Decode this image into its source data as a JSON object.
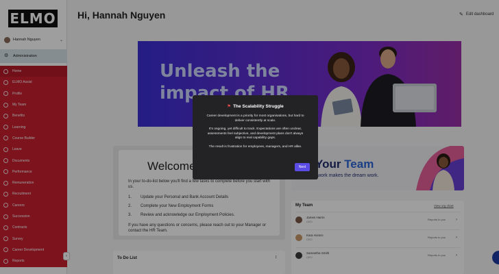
{
  "brand": {
    "logo_text": "ELMO"
  },
  "user": {
    "name": "Hannah Nguyen"
  },
  "sidebar": {
    "admin_label": "Administration",
    "items": [
      {
        "label": "Home"
      },
      {
        "label": "ELMO Assist"
      },
      {
        "label": "Profile"
      },
      {
        "label": "My Team"
      },
      {
        "label": "Benefits"
      },
      {
        "label": "Learning"
      },
      {
        "label": "Course Builder"
      },
      {
        "label": "Leave"
      },
      {
        "label": "Documents"
      },
      {
        "label": "Performance"
      },
      {
        "label": "Remuneration"
      },
      {
        "label": "Recruitment"
      },
      {
        "label": "Careers"
      },
      {
        "label": "Succession"
      },
      {
        "label": "Contracts"
      },
      {
        "label": "Survey"
      },
      {
        "label": "Career Development"
      },
      {
        "label": "Reports"
      }
    ],
    "active_index": 0,
    "colors": {
      "nav_bg": "#c9202f"
    }
  },
  "header": {
    "greeting": "Hi, Hannah Nguyen",
    "edit_dashboard": "Edit dashboard"
  },
  "banner": {
    "headline_line1": "Unleash the",
    "headline_line2": "impact of HR"
  },
  "welcome": {
    "title": "Welcome",
    "intro": "In your to-do-list below you'll find a few tasks to complete before you start with us.",
    "tasks": [
      {
        "num": "1.",
        "text": "Update your Personal and Bank Account Details"
      },
      {
        "num": "2.",
        "text": "Complete your New Employment Forms"
      },
      {
        "num": "3.",
        "text": "Review and acknowledge our Employment Policies."
      }
    ],
    "footer": "If you have any questions or concerns, please reach out to your Manager or contact the HR Team."
  },
  "team_banner": {
    "title_a": "Your ",
    "title_b": "Team",
    "subtitle": "work makes the dream work."
  },
  "my_team": {
    "heading": "My Team",
    "view_chart": "View org chart",
    "members": [
      {
        "name": "James Harris",
        "role": "CEO",
        "status": "Reports to you",
        "avatar_color": "#7a5a46"
      },
      {
        "name": "Kara Horaro",
        "role": "CEO",
        "status": "Reports to you",
        "avatar_color": "#c89a6a"
      },
      {
        "name": "Samantha Smith",
        "role": "CEO",
        "status": "Reports to you",
        "avatar_color": "#3b3b3b"
      }
    ]
  },
  "todo": {
    "label": "To Do List"
  },
  "modal": {
    "title": "The Scalability Struggle",
    "paragraphs": [
      "Career development is a priority for most organisations, but hard to deliver consistently at scale.",
      "It's ongoing, yet difficult to track. Expectations are often unclear, assessments feel subjective, and development plans don't always align to real capability gaps.",
      "The result is frustration for employees, managers, and HR alike."
    ],
    "next_label": "Next",
    "accent": "#5b4ce6"
  }
}
